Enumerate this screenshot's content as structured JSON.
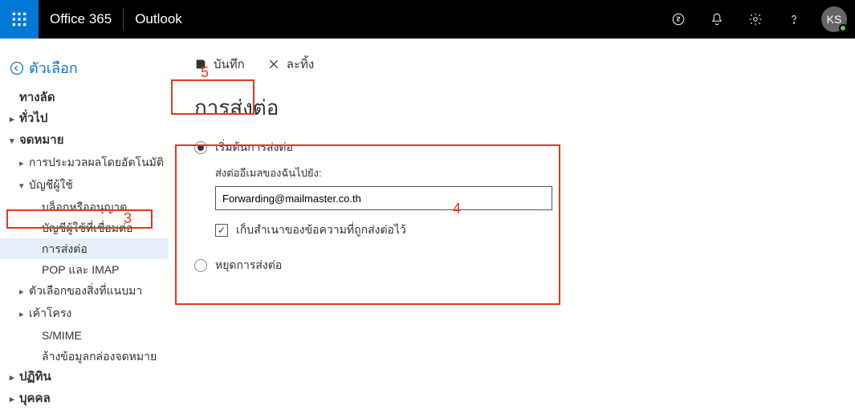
{
  "header": {
    "brand": "Office 365",
    "app": "Outlook",
    "avatar_initials": "KS"
  },
  "back_label": "ตัวเลือก",
  "sidebar": {
    "shortcuts": "ทางลัด",
    "general": "ทั่วไป",
    "mail": "จดหมาย",
    "auto_processing": "การประมวลผลโดยอัตโนมัติ",
    "accounts": "บัญชีผู้ใช้",
    "block_allow": "บล็อกหรืออนุญาต",
    "connected_accounts": "บัญชีผู้ใช้ที่เชื่อมต่อ",
    "forwarding": "การส่งต่อ",
    "pop_imap": "POP และ IMAP",
    "attachment_options": "ตัวเลือกของสิ่งที่แนบมา",
    "layout": "เค้าโครง",
    "smime": "S/MIME",
    "junk_cleanup": "ล้างข้อมูลกล่องจดหมาย",
    "calendar": "ปฏิทิน",
    "people": "บุคคล"
  },
  "toolbar": {
    "save": "บันทึก",
    "discard": "ละทิ้ง"
  },
  "page_title": "การส่งต่อ",
  "form": {
    "start_forwarding": "เริ่มต้นการส่งต่อ",
    "forward_to_label": "ส่งต่ออีเมลของฉันไปยัง:",
    "email_value": "Forwarding@mailmaster.co.th",
    "keep_copy": "เก็บสำเนาของข้อความที่ถูกส่งต่อไว้",
    "stop_forwarding": "หยุดการส่งต่อ"
  },
  "callouts": {
    "n3": "3",
    "n4": "4",
    "n5": "5"
  }
}
